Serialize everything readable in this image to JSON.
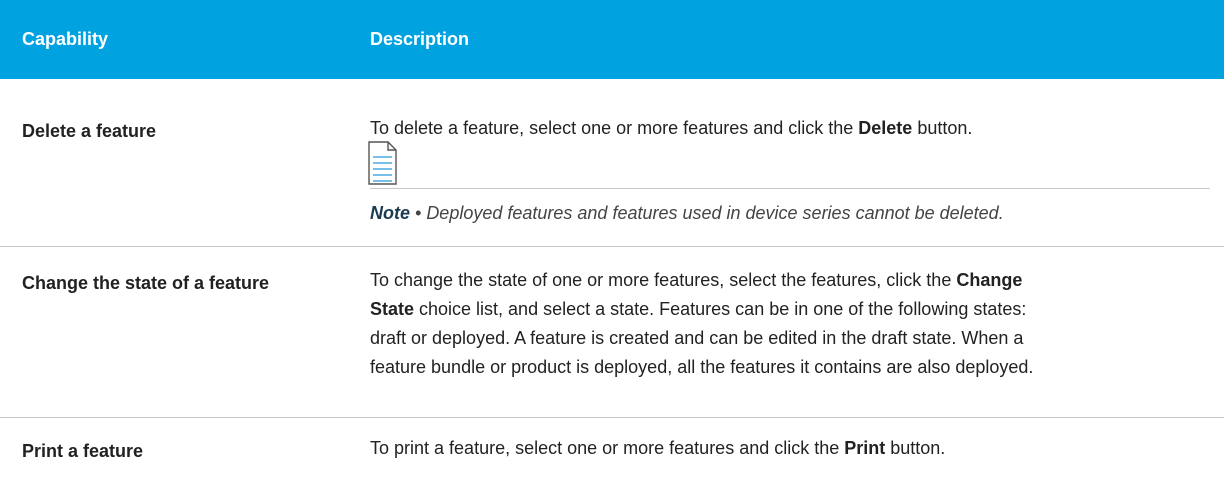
{
  "table": {
    "header": {
      "capability": "Capability",
      "description": "Description"
    },
    "rows": [
      {
        "capability": "Delete a feature",
        "description": {
          "pre": "To delete a feature, select one or more features and click the ",
          "bold": "Delete",
          "post": " button."
        },
        "note": {
          "icon": "document-note-icon",
          "label": "Note",
          "bullet": " • ",
          "text": "Deployed features and features used in device series cannot be deleted."
        }
      },
      {
        "capability": "Change the state of a feature",
        "description": {
          "line1_pre": "To change the state of one or more features, select the features, click the ",
          "line1_bold": "Change",
          "line2_bold": "State",
          "line2_post": " choice list, and select a state. Features can be in one of the following states:",
          "line3": "draft or deployed. A feature is created and can be edited in the draft state. When a",
          "line4": "feature bundle or product is deployed, all the features it contains are also deployed."
        }
      },
      {
        "capability": "Print a feature",
        "description": {
          "pre": "To print a feature, select one or more features and click the ",
          "bold": "Print",
          "post": " button."
        }
      }
    ]
  },
  "colors": {
    "header_bg": "#00A3E0",
    "header_text": "#ffffff",
    "icon_accent": "#4aa8e0"
  }
}
